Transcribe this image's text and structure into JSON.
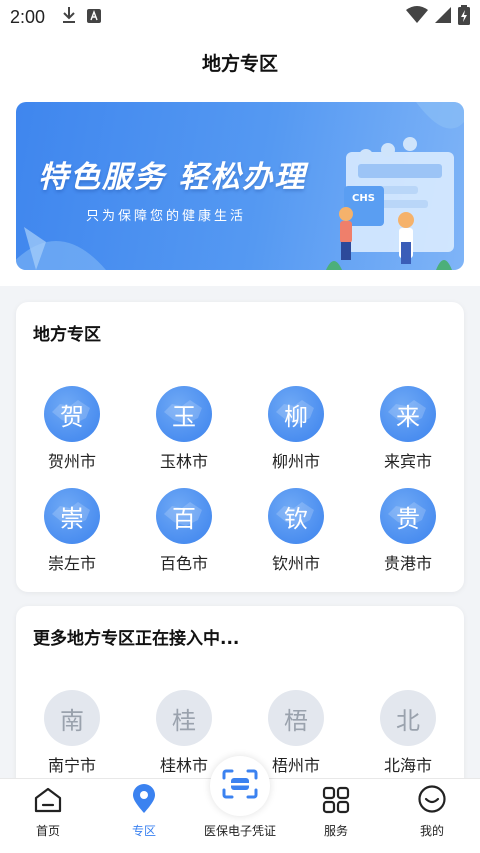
{
  "status": {
    "time": "2:00"
  },
  "header": {
    "title": "地方专区"
  },
  "banner": {
    "title": "特色服务  轻松办理",
    "subtitle": "只为保障您的健康生活",
    "logo_text": "CHS"
  },
  "section_active": {
    "title": "地方专区",
    "cities": [
      {
        "glyph": "贺",
        "name": "贺州市"
      },
      {
        "glyph": "玉",
        "name": "玉林市"
      },
      {
        "glyph": "柳",
        "name": "柳州市"
      },
      {
        "glyph": "来",
        "name": "来宾市"
      },
      {
        "glyph": "崇",
        "name": "崇左市"
      },
      {
        "glyph": "百",
        "name": "百色市"
      },
      {
        "glyph": "钦",
        "name": "钦州市"
      },
      {
        "glyph": "贵",
        "name": "贵港市"
      }
    ]
  },
  "section_upcoming": {
    "title": "更多地方专区正在接入中...",
    "cities": [
      {
        "glyph": "南",
        "name": "南宁市"
      },
      {
        "glyph": "桂",
        "name": "桂林市"
      },
      {
        "glyph": "梧",
        "name": "梧州市"
      },
      {
        "glyph": "北",
        "name": "北海市"
      }
    ]
  },
  "nav": {
    "items": [
      {
        "label": "首页",
        "icon": "home-icon"
      },
      {
        "label": "专区",
        "icon": "location-pin-icon"
      },
      {
        "label": "医保电子凭证",
        "icon": "scan-icon"
      },
      {
        "label": "服务",
        "icon": "grid-icon"
      },
      {
        "label": "我的",
        "icon": "smile-icon"
      }
    ],
    "active_index": 1
  },
  "colors": {
    "accent": "#3b82f0",
    "inactive_badge": "#e3e7ee"
  }
}
